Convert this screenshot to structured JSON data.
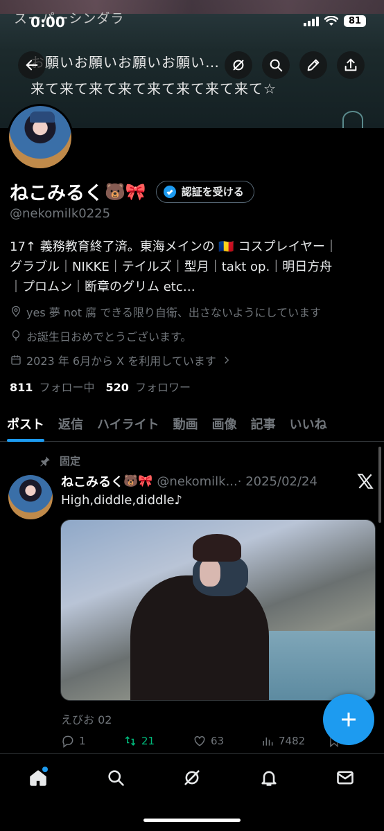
{
  "status_bar": {
    "time": "0:00",
    "battery": "81"
  },
  "banner": {
    "title": "スーパーシンダラ",
    "line1": "お願いお願いお願いお願い…",
    "line2": "来て来て来て来て来て来て来て来て☆"
  },
  "profile": {
    "display_name": "ねこみるく",
    "name_emoji": "🐻🎀",
    "verify_label": "認証を受ける",
    "handle": "@nekomilk0225",
    "bio_line1": "17↑ 義務教育終了済。東海メインの 🇷🇴 コスプレイヤー｜",
    "bio_line2": "グラブル｜NIKKE｜テイルズ｜型月｜takt op.｜明日方舟",
    "bio_line3": "｜プロムン｜断章のグリム etc…",
    "location": "yes 夢 not 腐 できる限り自衛、出さないようにしています",
    "birthday": "お誕生日おめでとうございます。",
    "joined": "2023 年 6月から X を利用しています",
    "following_count": "811",
    "following_label": "フォロー中",
    "followers_count": "520",
    "followers_label": "フォロワー"
  },
  "tabs": [
    "ポスト",
    "返信",
    "ハイライト",
    "動画",
    "画像",
    "記事",
    "いいね"
  ],
  "tweet": {
    "pinned_label": "固定",
    "name": "ねこみるく",
    "name_emoji": "🐻🎀",
    "handle": "@nekomilk...",
    "date": "· 2025/02/24",
    "text": "High,diddle,diddle♪",
    "credit": "えびお 02",
    "replies": "1",
    "retweets": "21",
    "likes": "63",
    "views": "7482"
  },
  "colors": {
    "accent": "#1d9bf0",
    "retweet": "#00ba7c",
    "muted": "#71767b"
  },
  "icons": [
    "back-icon",
    "grok-icon",
    "search-icon",
    "edit-icon",
    "share-icon",
    "pin-icon",
    "x-logo-icon",
    "plus-icon",
    "home-icon",
    "bell-icon",
    "mail-icon"
  ]
}
